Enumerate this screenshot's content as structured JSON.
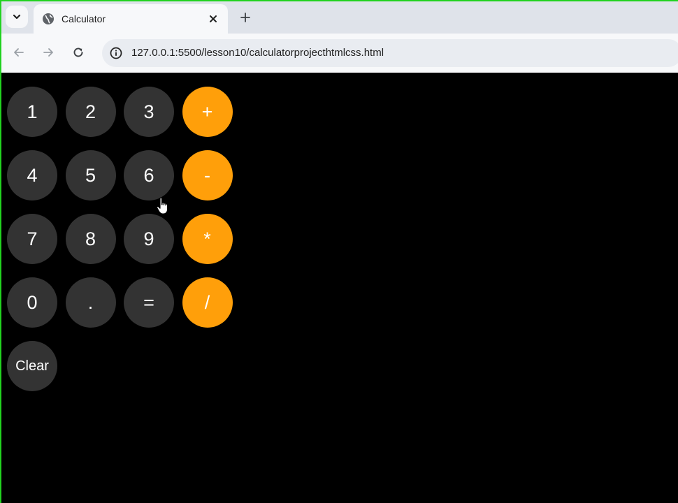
{
  "browser": {
    "tab": {
      "title": "Calculator",
      "favicon": "globe-icon"
    },
    "new_tab_icon": "plus-icon",
    "tab_menu_icon": "chevron-down-icon",
    "nav": {
      "back_icon": "back-arrow-icon",
      "forward_icon": "forward-arrow-icon",
      "reload_icon": "reload-icon"
    },
    "address_bar": {
      "url": "127.0.0.1:5500/lesson10/calculatorprojecthtmlcss.html",
      "site_info_icon": "info-icon"
    }
  },
  "calculator": {
    "rows": [
      {
        "digits": [
          "1",
          "2",
          "3"
        ],
        "operator": "+"
      },
      {
        "digits": [
          "4",
          "5",
          "6"
        ],
        "operator": "-"
      },
      {
        "digits": [
          "7",
          "8",
          "9"
        ],
        "operator": "*"
      },
      {
        "digits": [
          "0",
          ".",
          "="
        ],
        "operator": "/"
      }
    ],
    "clear_label": "Clear",
    "colors": {
      "background": "#000000",
      "digit_button": "#333333",
      "operator_button": "#ff9f0a",
      "text": "#ffffff"
    }
  },
  "pointer": {
    "icon": "hand-pointer-icon"
  }
}
